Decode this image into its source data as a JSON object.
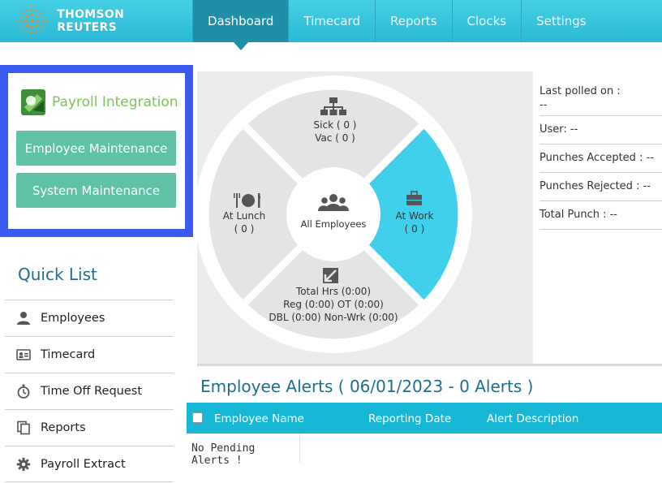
{
  "brand": {
    "name": "THOMSON REUTERS"
  },
  "nav": {
    "tabs": [
      {
        "label": "Dashboard",
        "active": true
      },
      {
        "label": "Timecard",
        "active": false
      },
      {
        "label": "Reports",
        "active": false
      },
      {
        "label": "Clocks",
        "active": false
      },
      {
        "label": "Settings",
        "active": false
      }
    ]
  },
  "payroll": {
    "title": "Payroll Integration",
    "employee_maintenance": "Employee Maintenance",
    "system_maintenance": "System Maintenance"
  },
  "quick_list": {
    "title": "Quick List",
    "items": [
      {
        "label": "Employees",
        "icon": "person-icon"
      },
      {
        "label": "Timecard",
        "icon": "id-card-icon"
      },
      {
        "label": "Time Off Request",
        "icon": "stopwatch-icon"
      },
      {
        "label": "Reports",
        "icon": "copy-docs-icon"
      },
      {
        "label": "Payroll Extract",
        "icon": "gear-icon"
      }
    ]
  },
  "wheel": {
    "center": "All Employees",
    "sick": "Sick ( 0 )",
    "vac": "Vac ( 0 )",
    "at_lunch": "At Lunch",
    "at_lunch_count": "( 0 )",
    "at_work": "At Work",
    "at_work_count": "( 0 )",
    "total_hrs": "Total Hrs (0:00)",
    "reg_ot": "Reg (0:00) OT (0:00)",
    "dbl_nonwrk": "DBL (0:00) Non-Wrk (0:00)",
    "colors": {
      "active_segment": "#41d0ec",
      "segment": "#e4e4e4"
    }
  },
  "stats": {
    "last_polled_label": "Last polled on :",
    "last_polled_value": "--",
    "user": "User: --",
    "punches_accepted": "Punches Accepted : --",
    "punches_rejected": "Punches Rejected : --",
    "total_punch": "Total Punch : --"
  },
  "alerts": {
    "title": "Employee Alerts ( 06/01/2023 - 0 Alerts )",
    "columns": [
      "Employee Name",
      "Reporting Date",
      "Alert Description"
    ],
    "empty": "No Pending Alerts !"
  }
}
